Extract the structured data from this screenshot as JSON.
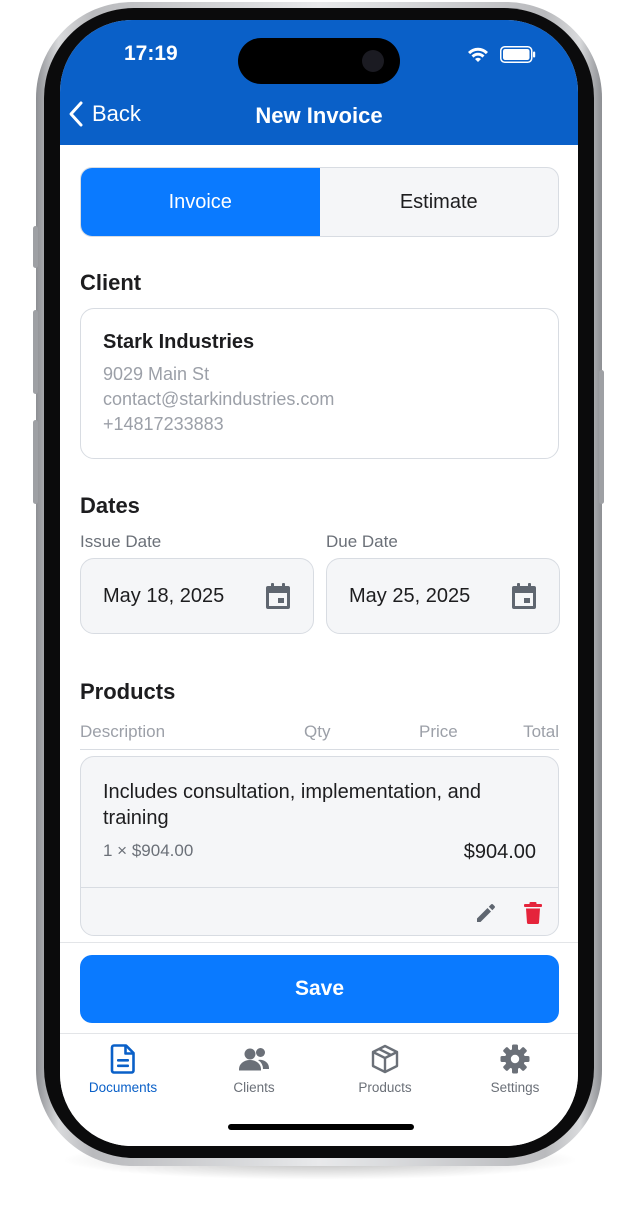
{
  "status_bar": {
    "time": "17:19"
  },
  "header": {
    "back_label": "Back",
    "title": "New Invoice"
  },
  "doc_type": {
    "tabs": [
      "Invoice",
      "Estimate"
    ],
    "selected": "Invoice"
  },
  "client": {
    "section_title": "Client",
    "name": "Stark Industries",
    "address": "9029 Main St",
    "email": "contact@starkindustries.com",
    "phone": "+14817233883"
  },
  "dates": {
    "section_title": "Dates",
    "issue_label": "Issue Date",
    "issue_value": "May 18, 2025",
    "due_label": "Due Date",
    "due_value": "May 25, 2025"
  },
  "products": {
    "section_title": "Products",
    "columns": [
      "Description",
      "Qty",
      "Price",
      "Total"
    ],
    "items": [
      {
        "description": "Includes consultation, implementation, and training",
        "qty_price": "1 × $904.00",
        "total": "$904.00"
      }
    ]
  },
  "save_label": "Save",
  "tabbar": {
    "items": [
      {
        "label": "Documents",
        "icon": "document-icon"
      },
      {
        "label": "Clients",
        "icon": "users-icon"
      },
      {
        "label": "Products",
        "icon": "box-icon"
      },
      {
        "label": "Settings",
        "icon": "gear-icon"
      }
    ],
    "active": "Documents"
  },
  "colors": {
    "header": "#0a60c8",
    "accent": "#0a7aff",
    "delete": "#e5243b"
  }
}
